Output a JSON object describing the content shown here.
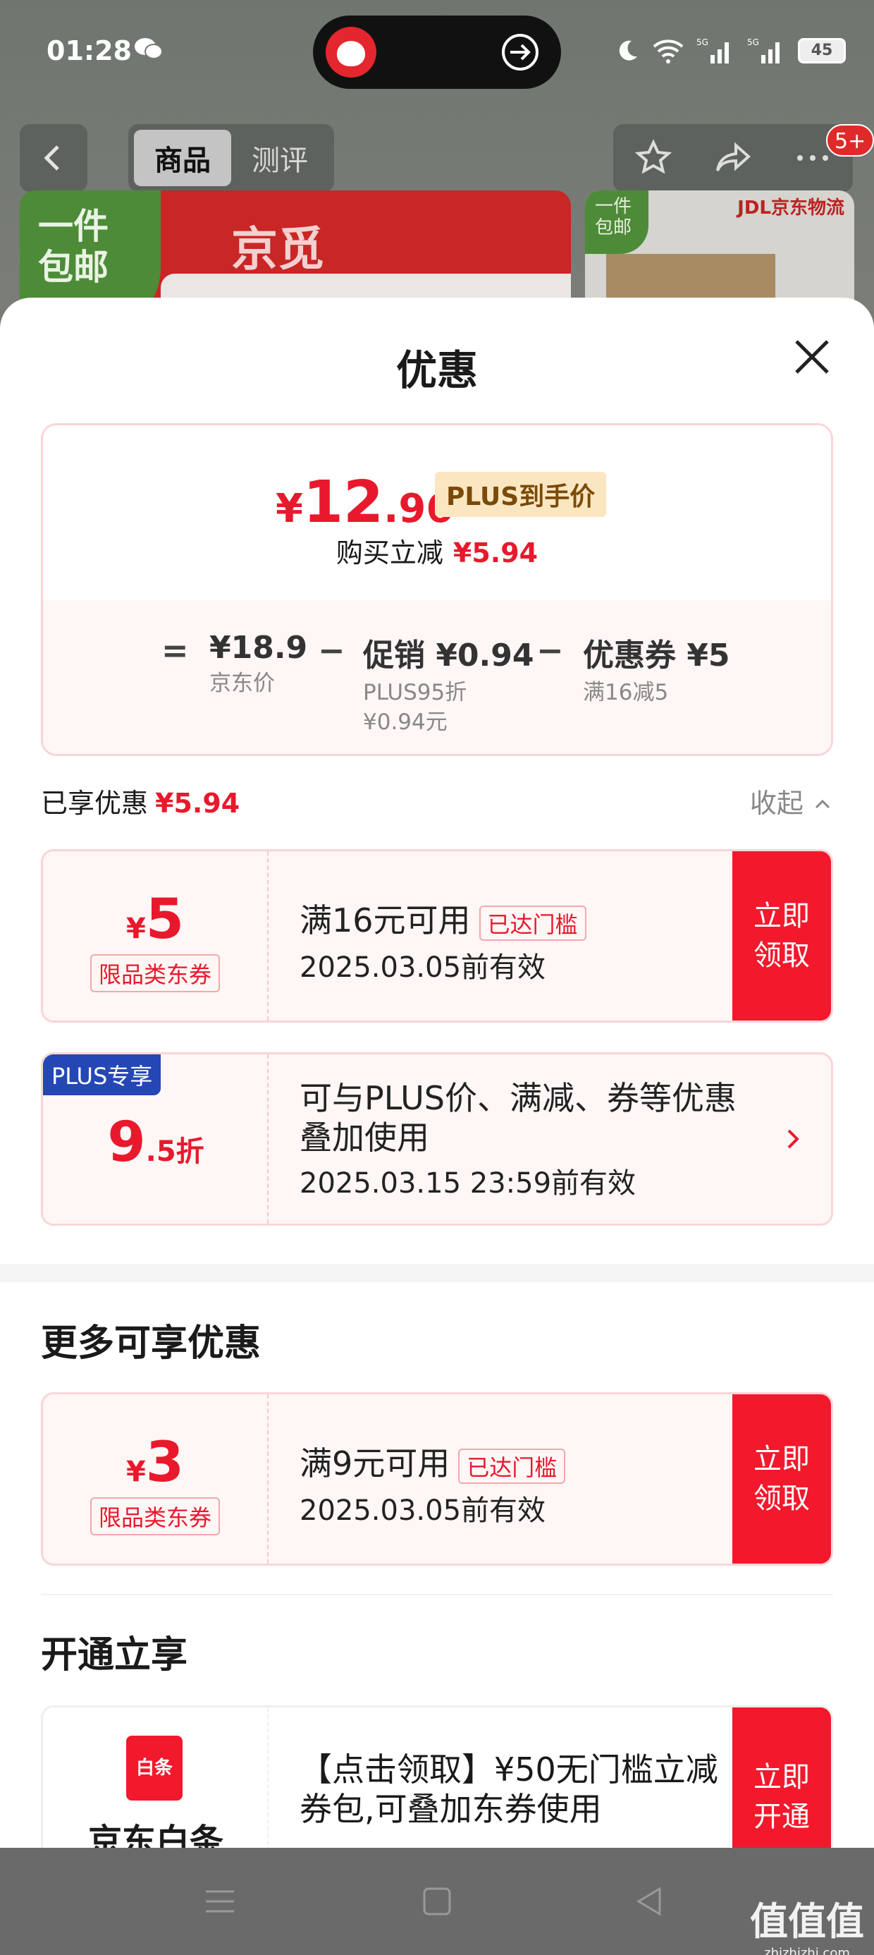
{
  "status": {
    "time": "01:28",
    "battery": "45"
  },
  "nav": {
    "tab_goods": "商品",
    "tab_review": "测评",
    "badge": "5+"
  },
  "banner": {
    "free_ship": "一件\n包邮",
    "brand": "京觅",
    "free_ship_small": "一件\n包邮",
    "logistics": "JDL京东物流"
  },
  "sheet": {
    "title": "优惠"
  },
  "price": {
    "currency": "¥",
    "integer": "12",
    "decimal": ".96",
    "plus_tag": "PLUS到手价",
    "direct_label": "购买立减",
    "direct_value": "¥5.94"
  },
  "breakdown": {
    "eq": "=",
    "jd_price": "¥18.9",
    "jd_label": "京东价",
    "promo": "促销 ¥0.94",
    "promo_sub1": "PLUS95折",
    "promo_sub2": "¥0.94元",
    "coupon": "优惠券 ¥5",
    "coupon_sub": "满16减5",
    "minus": "−"
  },
  "enjoyed": {
    "label": "已享优惠",
    "value": "¥5.94",
    "collapse": "收起"
  },
  "coupon1": {
    "cur": "¥",
    "amount": "5",
    "category": "限品类东券",
    "condition": "满16元可用",
    "tag": "已达门槛",
    "valid": "2025.03.05前有效",
    "cta": "立即领取"
  },
  "plus": {
    "ribbon": "PLUS专享",
    "discount": "9",
    "discount_suffix": ".5折",
    "desc": "可与PLUS价、满减、券等优惠叠加使用",
    "valid": "2025.03.15 23:59前有效"
  },
  "more": {
    "title": "更多可享优惠"
  },
  "coupon2": {
    "cur": "¥",
    "amount": "3",
    "category": "限品类东券",
    "condition": "满9元可用",
    "tag": "已达门槛",
    "valid": "2025.03.05前有效",
    "cta": "立即领取"
  },
  "open": {
    "title": "开通立享"
  },
  "baitiao": {
    "icon": "白条",
    "name": "京东白条",
    "desc": "【点击领取】¥50无门槛立减券包,可叠加东券使用",
    "cta": "立即开通"
  },
  "watermark": {
    "text": "值值值",
    "url": "zhizhizhi.com"
  }
}
